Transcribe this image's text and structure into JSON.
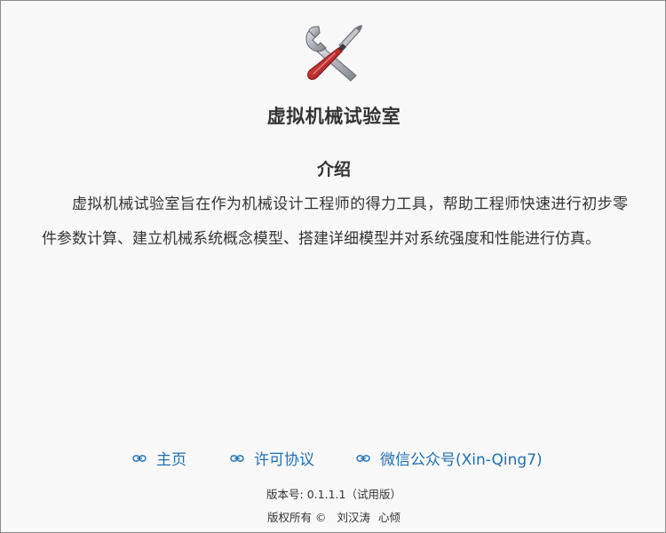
{
  "app": {
    "title": "虚拟机械试验室",
    "logo_icon": "wrench-screwdriver-icon"
  },
  "intro": {
    "heading": "介绍",
    "text": "虚拟机械试验室旨在作为机械设计工程师的得力工具，帮助工程师快速进行初步零件参数计算、建立机械系统概念模型、搭建详细模型并对系统强度和性能进行仿真。"
  },
  "links": [
    {
      "label": "主页",
      "icon": "link-icon"
    },
    {
      "label": "许可协议",
      "icon": "link-icon"
    },
    {
      "label": "微信公众号(Xin-Qing7)",
      "icon": "link-icon"
    }
  ],
  "footer": {
    "version": "版本号: 0.1.1.1（试用版）",
    "copyright_label": "版权所有 ©",
    "authors": [
      "刘汉涛",
      "心倾"
    ]
  },
  "colors": {
    "link": "#1f6fb5",
    "text": "#333333",
    "background": "#f9f9fa",
    "border": "#8a8a8a"
  }
}
